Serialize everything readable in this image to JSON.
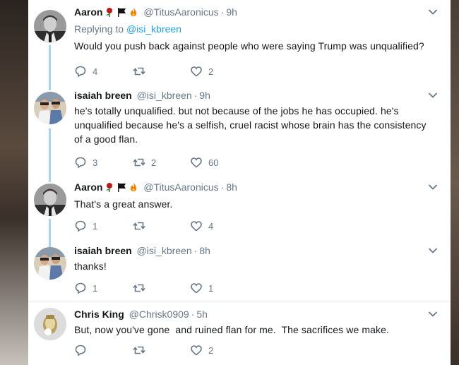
{
  "tweets": [
    {
      "name": "Aaron",
      "handle": "@TitusAaronicus",
      "time": "9h",
      "emojis": [
        "rose-icon",
        "black-flag-icon",
        "fire-icon"
      ],
      "replying_prefix": "Replying to",
      "replying_to": "@isi_kbreen",
      "text": "Would you push back against people who were saying Trump was unqualified?",
      "replies": "4",
      "retweets": "",
      "likes": "2"
    },
    {
      "name": "isaiah breen",
      "handle": "@isi_kbreen",
      "time": "9h",
      "emojis": [],
      "text": "he's totally unqualified. but not because of the jobs he has occupied. he's unqualified because he's a selfish, cruel racist whose brain has the consistency of a good flan.",
      "replies": "3",
      "retweets": "2",
      "likes": "60"
    },
    {
      "name": "Aaron",
      "handle": "@TitusAaronicus",
      "time": "8h",
      "emojis": [
        "rose-icon",
        "black-flag-icon",
        "fire-icon"
      ],
      "text": "That's a great answer.",
      "replies": "1",
      "retweets": "",
      "likes": "4"
    },
    {
      "name": "isaiah breen",
      "handle": "@isi_kbreen",
      "time": "8h",
      "emojis": [],
      "text": "thanks!",
      "replies": "1",
      "retweets": "",
      "likes": "1"
    },
    {
      "name": "Chris King",
      "handle": "@Chrisk0909",
      "time": "5h",
      "emojis": [],
      "text": "But, now you've gone  and ruined flan for me.  The sacrifices we make.",
      "replies": "",
      "retweets": "",
      "likes": "2"
    }
  ],
  "colors": {
    "link": "#1da1f2",
    "muted": "#657786",
    "text": "#14171a",
    "thread_line": "#a5d4f7"
  }
}
